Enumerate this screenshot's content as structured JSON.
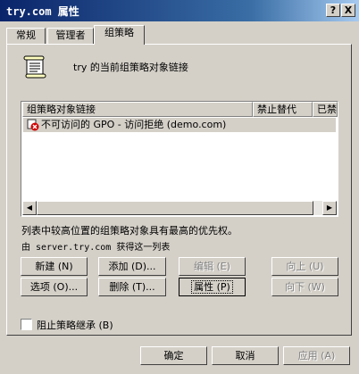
{
  "window": {
    "title": "try.com 属性",
    "help_label": "?",
    "close_label": "X"
  },
  "tabs": [
    {
      "label": "常规"
    },
    {
      "label": "管理者"
    },
    {
      "label": "组策略"
    }
  ],
  "header": {
    "description": "try 的当前组策略对象链接"
  },
  "list": {
    "columns": [
      "组策略对象链接",
      "禁止替代",
      "已禁"
    ],
    "rows": [
      {
        "name": "不可访问的 GPO - 访问拒绝 (demo.com)"
      }
    ],
    "scroll_left": "◀",
    "scroll_right": "▶"
  },
  "info": {
    "priority_note": "列表中较高位置的组策略对象具有最高的优先权。",
    "source_note": "由 server.try.com 获得这一列表"
  },
  "buttons": {
    "new": "新建 (N)",
    "add": "添加 (D)...",
    "edit": "编辑 (E)",
    "up": "向上 (U)",
    "options": "选项 (O)...",
    "delete": "删除 (T)...",
    "properties": "属性 (P)",
    "down": "向下 (W)"
  },
  "block": {
    "label": "阻止策略继承 (B)",
    "checked": false
  },
  "footer": {
    "ok": "确定",
    "cancel": "取消",
    "apply": "应用 (A)"
  }
}
